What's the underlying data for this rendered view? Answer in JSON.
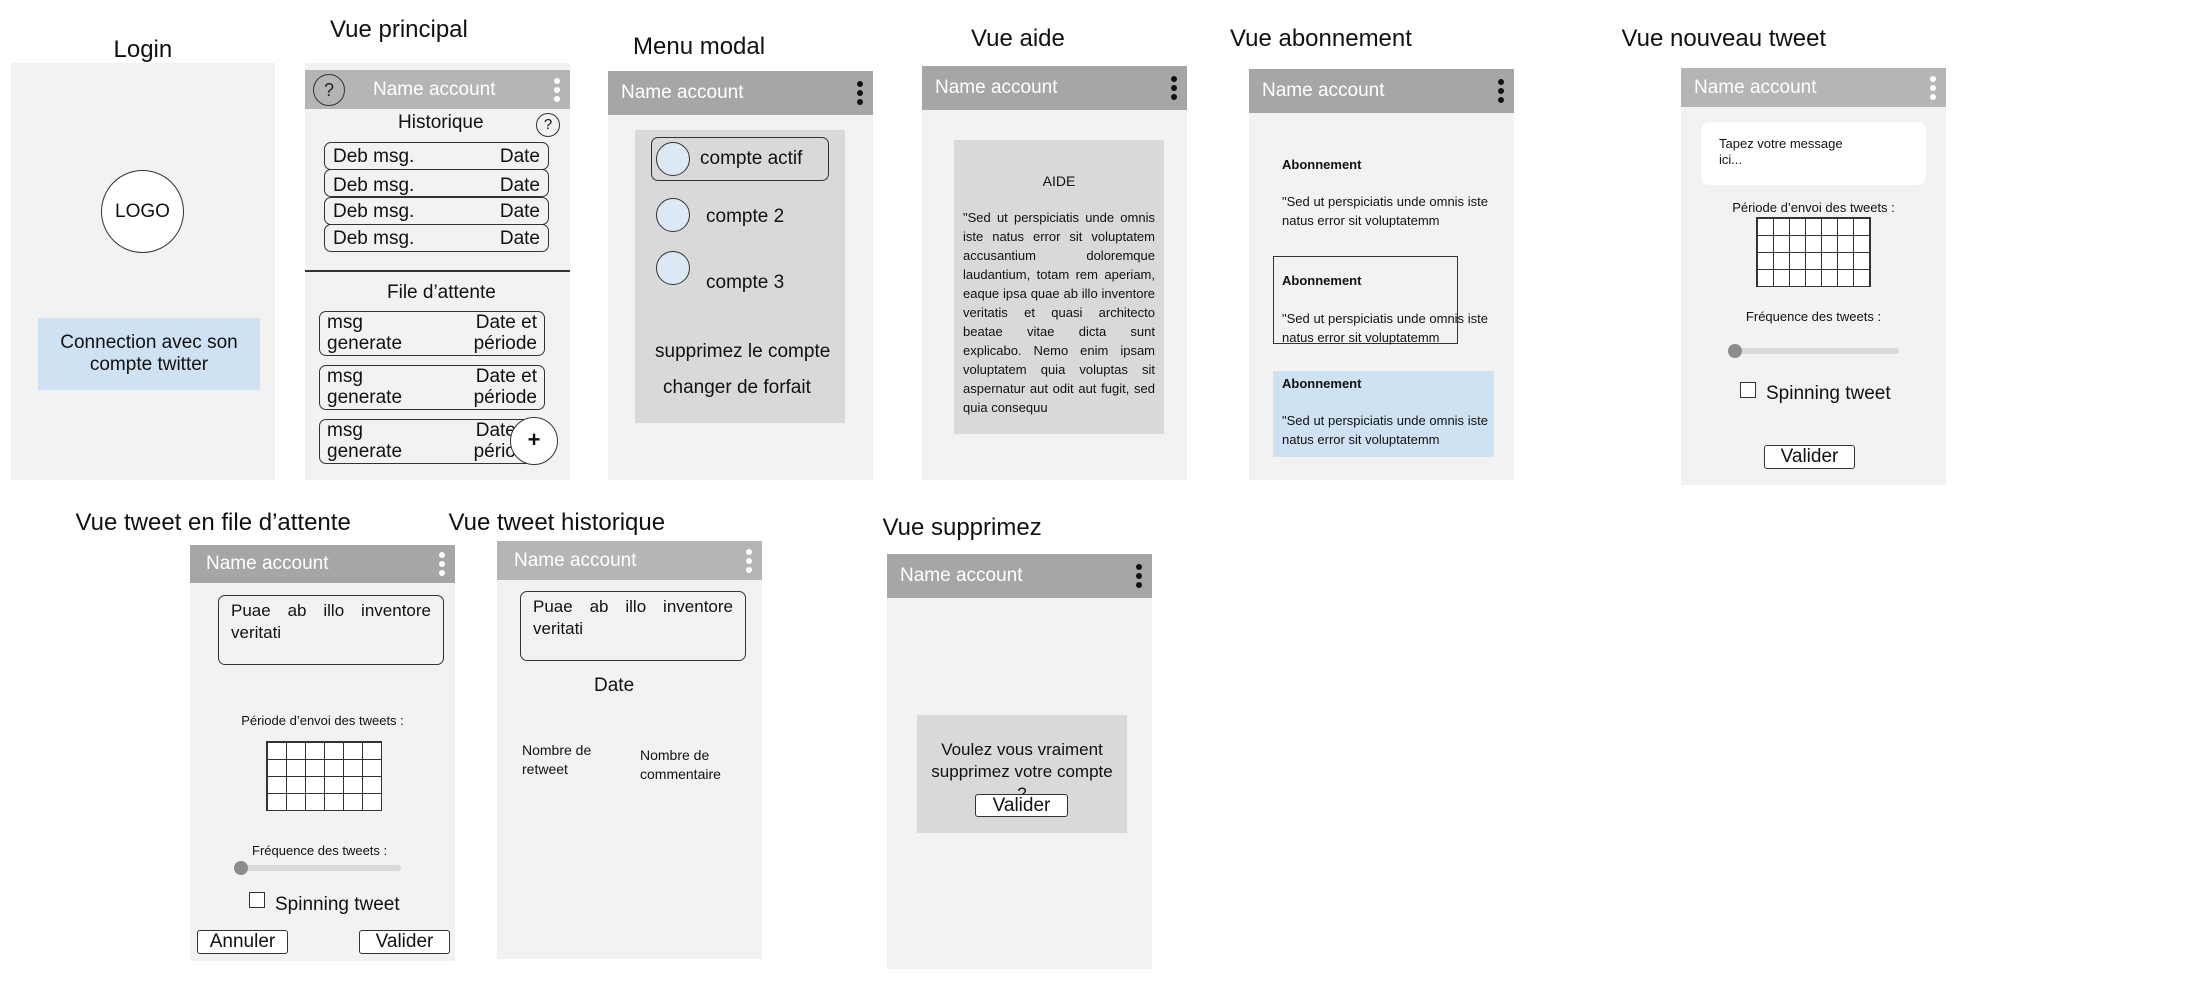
{
  "titles": {
    "login": "Login",
    "principal": "Vue principal",
    "menu": "Menu modal",
    "aide": "Vue aide",
    "abonnement": "Vue abonnement",
    "nouveau": "Vue nouveau tweet",
    "file": "Vue tweet en file d’attente",
    "historique": "Vue tweet historique",
    "supprimez": "Vue supprimez"
  },
  "account_name": "Name account",
  "login": {
    "logo": "LOGO",
    "connect_button": "Connection avec son compte twitter"
  },
  "principal": {
    "help": "?",
    "historique_label": "Historique",
    "history_rows": [
      {
        "msg": "Deb msg.",
        "date": "Date"
      },
      {
        "msg": "Deb msg.",
        "date": "Date"
      },
      {
        "msg": "Deb msg.",
        "date": "Date"
      },
      {
        "msg": "Deb msg.",
        "date": "Date"
      }
    ],
    "queue_label": "File d’attente",
    "queue_rows": [
      {
        "msg1": "msg",
        "msg2": "generate",
        "d1": "Date et",
        "d2": "période"
      },
      {
        "msg1": "msg",
        "msg2": "generate",
        "d1": "Date et",
        "d2": "période"
      },
      {
        "msg1": "msg",
        "msg2": "generate",
        "d1": "Date et",
        "d2": "période"
      }
    ],
    "add": "+"
  },
  "menu": {
    "accounts": [
      "compte actif",
      "compte 2",
      "compte 3"
    ],
    "delete_account": "supprimez le compte",
    "change_plan": "changer de forfait"
  },
  "aide": {
    "heading": "AIDE",
    "body": "\"Sed ut perspiciatis unde omnis iste natus error sit voluptatem accusantium doloremque laudantium, totam rem aperiam, eaque ipsa quae ab illo inventore veritatis et quasi architecto beatae vitae dicta sunt explicabo. Nemo enim ipsam voluptatem quia voluptas sit aspernatur aut odit aut fugit, sed quia consequu"
  },
  "abonnement": {
    "plans": [
      {
        "title": "Abonnement",
        "text": "\"Sed ut perspiciatis unde omnis iste natus error sit voluptatemm"
      },
      {
        "title": "Abonnement",
        "text": "\"Sed ut perspiciatis unde omnis iste natus error sit voluptatemm"
      },
      {
        "title": "Abonnement",
        "text": "\"Sed ut perspiciatis unde omnis iste natus error sit voluptatemm"
      }
    ],
    "highlight_color": "#cfe2f3"
  },
  "nouveau": {
    "placeholder": "Tapez votre message ici...",
    "periode_label": "Période d’envoi des tweets :",
    "frequence_label": "Fréquence des tweets :",
    "spinning_label": "Spinning tweet",
    "valider": "Valider"
  },
  "file": {
    "message": "Puae ab illo inventore veritati",
    "periode_label": "Période d’envoi des tweets :",
    "frequence_label": "Fréquence des tweets :",
    "spinning_label": "Spinning tweet",
    "annuler": "Annuler",
    "valider": "Valider"
  },
  "historique": {
    "message": "Puae ab illo inventore veritati",
    "date": "Date",
    "retweet_label": "Nombre de retweet",
    "comment_label": "Nombre de commentaire"
  },
  "supprimez": {
    "question": "Voulez vous vraiment supprimez votre compte ?",
    "valider": "Valider"
  },
  "colors": {
    "screen_bg": "#f2f2f2",
    "header_bg": "#a6a6a6",
    "login_button_bg": "#cfe2f3",
    "avatar_fill": "#dce9f5",
    "panel_bg": "#d9d9d9"
  }
}
